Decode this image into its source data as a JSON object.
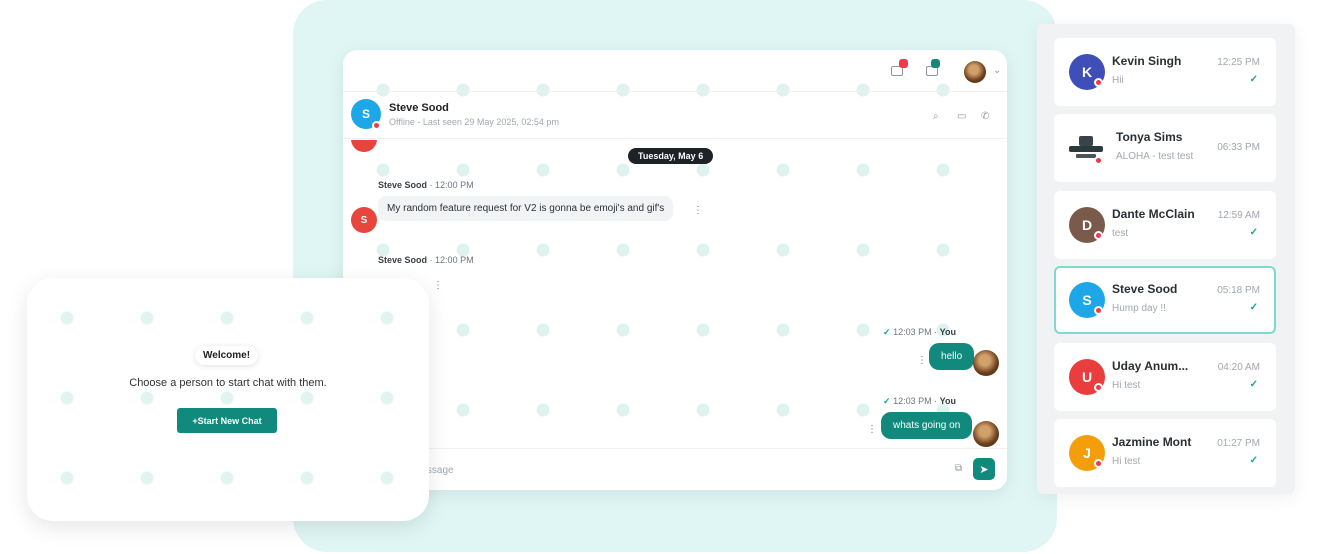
{
  "chat": {
    "contact": {
      "initial": "S",
      "name": "Steve Sood",
      "status": "Offline - Last seen 29 May 2025, 02:54 pm"
    },
    "date_separator": "Tuesday, May 6",
    "messages": [
      {
        "sender": "Steve Sood",
        "time": "12:00 PM",
        "avatar_initial": "S",
        "text": "My random feature request for V2 is gonna be emoji's and gif's"
      },
      {
        "sender": "Steve Sood",
        "time": "12:00 PM"
      },
      {
        "sender": "You",
        "time": "12:03 PM",
        "text": "hello"
      },
      {
        "sender": "You",
        "time": "12:03 PM",
        "text": "whats going on"
      }
    ],
    "composer_placeholder": "Message",
    "separator": "·",
    "kebab": "⋮"
  },
  "welcome": {
    "title": "Welcome!",
    "text": "Choose a person to start chat with them.",
    "button": "+Start New Chat"
  },
  "contacts": [
    {
      "initial": "K",
      "name": "Kevin Singh",
      "message": "Hii",
      "time": "12:25 PM",
      "read": true,
      "color": "#3f4fb8"
    },
    {
      "initial": "",
      "name": "Tonya Sims",
      "message": "ALOHA - test test",
      "time": "06:33 PM",
      "read": false,
      "color": "#2c3a3e"
    },
    {
      "initial": "D",
      "name": "Dante McClain",
      "message": "test",
      "time": "12:59 AM",
      "read": true,
      "color": "#7a5a4a"
    },
    {
      "initial": "S",
      "name": "Steve Sood",
      "message": "Hump day !!",
      "time": "05:18 PM",
      "read": true,
      "color": "#1ea7e8",
      "active": true
    },
    {
      "initial": "U",
      "name": "Uday Anum...",
      "message": "Hi test",
      "time": "04:20 AM",
      "read": true,
      "color": "#ea3d3d"
    },
    {
      "initial": "J",
      "name": "Jazmine Mont",
      "message": "Hi test",
      "time": "01:27 PM",
      "read": true,
      "color": "#f59e0b"
    }
  ],
  "colors": {
    "accent": "#118a7d",
    "online_badge": "#ef3a4b",
    "steve": "#1ea7e8",
    "steve_red": "#e8453c"
  },
  "icons": {
    "check": "✓",
    "send": "➤",
    "attach": "⧉",
    "search": "⌕",
    "video": "▭",
    "phone": "✆",
    "chevron": "⌄"
  }
}
